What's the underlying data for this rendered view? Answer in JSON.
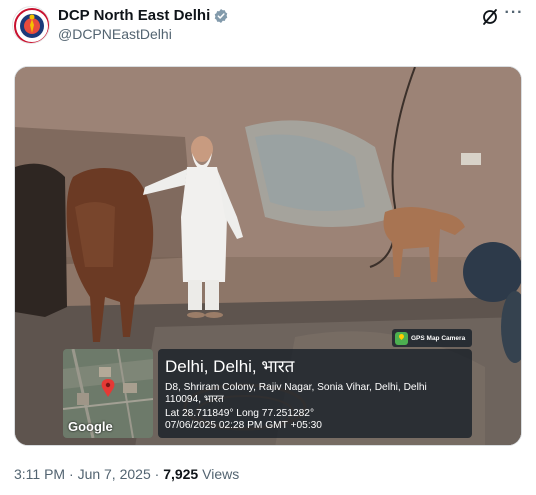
{
  "author": {
    "display_name": "DCP North East Delhi",
    "handle": "@DCPNEastDelhi",
    "avatar_icon": "delhi-police-emblem",
    "verified_icon": "verified-badge-icon",
    "verified_color": "#829aab"
  },
  "actions": {
    "grok_icon": "grok-icon",
    "more_label": "···"
  },
  "media": {
    "gps_app_label": "GPS Map Camera",
    "map_attribution": "Google",
    "location_title": "Delhi, Delhi, भारत",
    "address": "D8, Shriram Colony, Rajiv Nagar, Sonia Vihar, Delhi, Delhi 110094, भारत",
    "coordinates": "Lat 28.711849° Long 77.251282°",
    "datetime": "07/06/2025 02:28 PM GMT +05:30"
  },
  "footer": {
    "time": "3:11 PM",
    "separator": "·",
    "date": "Jun 7, 2025",
    "views_count": "7,925",
    "views_label": "Views"
  }
}
